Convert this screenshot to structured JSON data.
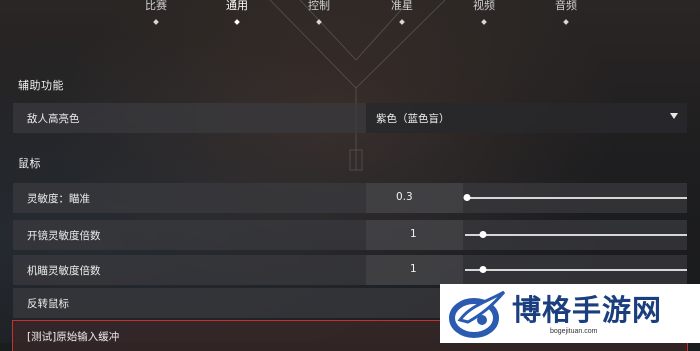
{
  "tabs": [
    {
      "label": "比赛",
      "active": false
    },
    {
      "label": "通用",
      "active": true
    },
    {
      "label": "控制",
      "active": false
    },
    {
      "label": "准星",
      "active": false
    },
    {
      "label": "视频",
      "active": false
    },
    {
      "label": "音频",
      "active": false
    }
  ],
  "accessibility": {
    "title": "辅助功能",
    "enemy_highlight": {
      "label": "敌人高亮色",
      "value": "紫色（蓝色盲）"
    }
  },
  "mouse": {
    "title": "鼠标",
    "sensitivity_aim": {
      "label": "灵敏度：瞄准",
      "value": "0.3",
      "slider_fraction": 0.01
    },
    "scope_multiplier": {
      "label": "开镜灵敏度倍数",
      "value": "1",
      "slider_fraction": 0.08
    },
    "aim_multiplier": {
      "label": "机瞄灵敏度倍数",
      "value": "1",
      "slider_fraction": 0.08
    },
    "invert": {
      "label": "反转鼠标"
    },
    "raw_input": {
      "label": "[测试]原始输入缓冲"
    }
  },
  "watermark": {
    "title": "博格手游网",
    "url": "bogejituan.com"
  },
  "colors": {
    "highlight_border": "#c83030",
    "watermark_text": "#1b3f7e",
    "watermark_logo": "#2a5bb0"
  }
}
